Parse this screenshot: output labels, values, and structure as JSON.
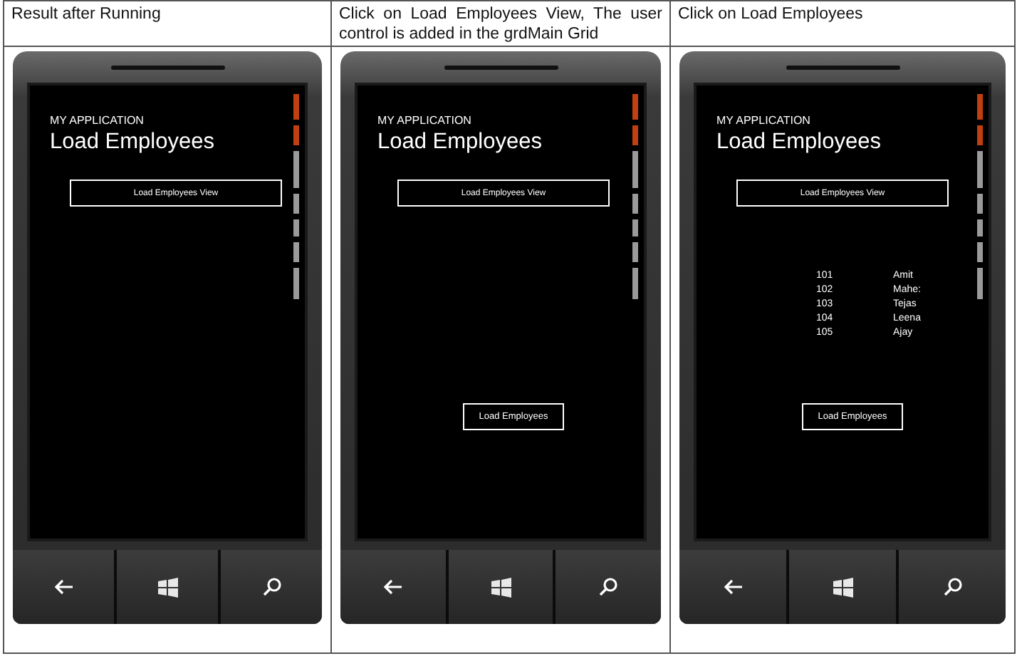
{
  "columns": [
    {
      "caption": "Result after Running",
      "phone": {
        "app_title": "MY APPLICATION",
        "page_title": "Load Employees",
        "view_button": "Load Employees View"
      }
    },
    {
      "caption": "Click on Load Employees View, The user control is added in the grdMain Grid",
      "phone": {
        "app_title": "MY APPLICATION",
        "page_title": "Load Employees",
        "view_button": "Load Employees View",
        "load_button": "Load Employees"
      }
    },
    {
      "caption": "Click on Load Employees",
      "phone": {
        "app_title": "MY APPLICATION",
        "page_title": "Load Employees",
        "view_button": "Load Employees View",
        "employees": [
          {
            "id": "101",
            "name": "Amit"
          },
          {
            "id": "102",
            "name": "Mahe:"
          },
          {
            "id": "103",
            "name": "Tejas"
          },
          {
            "id": "104",
            "name": "Leena"
          },
          {
            "id": "105",
            "name": "Ajay"
          }
        ],
        "load_button": "Load Employees"
      }
    }
  ]
}
